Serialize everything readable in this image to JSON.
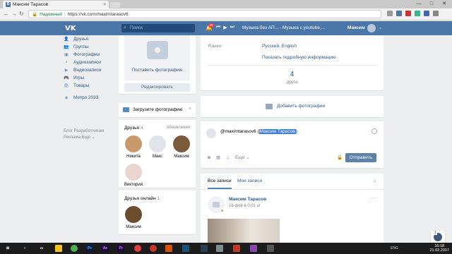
{
  "browser": {
    "tab_title": "Максим Тарасов",
    "tab_close": "×",
    "secure_label": "Надежный",
    "url": "https://vk.com/maximtarasov6",
    "win_min": "—",
    "win_max": "□",
    "win_close": "✕"
  },
  "header": {
    "logo": "VK",
    "search_placeholder": "Поиск",
    "notif_count": "45",
    "track": "Музыка без АП... - Музыка с youtube,...",
    "user_name": "Максим",
    "chevron": "⌄"
  },
  "menu": {
    "items": [
      {
        "label": "Друзья",
        "icon": "user-icon"
      },
      {
        "label": "Группы",
        "icon": "group-icon"
      },
      {
        "label": "Фотографии",
        "icon": "photo-icon"
      },
      {
        "label": "Аудиозаписи",
        "icon": "audio-icon"
      },
      {
        "label": "Видеозаписи",
        "icon": "video-icon"
      },
      {
        "label": "Игры",
        "icon": "game-icon"
      },
      {
        "label": "Товары",
        "icon": "goods-icon"
      }
    ],
    "app_item": "Метро 2033",
    "footer_line1": "Блог   Разработчикам",
    "footer_line2": "Реклама   Ещё ⌄"
  },
  "profile": {
    "put_photo": "Поставить фотографию",
    "edit": "Редактировать",
    "upload_photo": "Загрузите фотографию",
    "upload_close": "×"
  },
  "friends": {
    "title": "Друзья",
    "count": "4",
    "updates": "обновления",
    "list": [
      {
        "name": "Никита",
        "color": "#c89a6b"
      },
      {
        "name": "Макс",
        "color": "#e1e5eb"
      },
      {
        "name": "Максим",
        "color": "#7a5a3a"
      },
      {
        "name": "Виктория",
        "color": "#e9d5cf"
      }
    ],
    "online_title": "Друзья онлайн",
    "online_count": "1",
    "online_list": [
      {
        "name": "Максим",
        "color": "#6b4c2e"
      }
    ]
  },
  "info": {
    "lang_label": "Языки:",
    "lang_value": "Русский, English",
    "more_info": "Показать подробную информацию",
    "friends_count": "4",
    "friends_label": "друга"
  },
  "add_photo": "Добавить фотографии",
  "composer": {
    "text_prefix": "@maximtarasov6 (",
    "text_highlight": "Максим Тарасов",
    "text_suffix": ")",
    "more": "Ещё ⌄",
    "send": "Отправить"
  },
  "wall": {
    "tab_all": "Все записи",
    "tab_mine": "Мои записи",
    "post_author": "Максим Тарасов",
    "post_date": "16 фев в 0:01 ⇄",
    "post_more": "···"
  },
  "taskbar": {
    "time": "16:18",
    "date": "21.02.2017",
    "lang": "ENG"
  }
}
